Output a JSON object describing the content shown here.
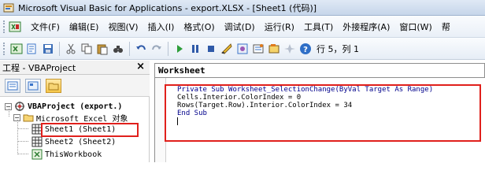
{
  "window": {
    "title": "Microsoft Visual Basic for Applications - export.XLSX - [Sheet1 (代码)]"
  },
  "menu": {
    "items": [
      "文件(F)",
      "编辑(E)",
      "视图(V)",
      "插入(I)",
      "格式(O)",
      "调试(D)",
      "运行(R)",
      "工具(T)",
      "外接程序(A)",
      "窗口(W)",
      "帮"
    ]
  },
  "toolbar": {
    "position_text": "行 5，列 1"
  },
  "project": {
    "header": "工程 - VBAProject",
    "close": "×",
    "tree": {
      "root": "VBAProject (export.)",
      "folder": "Microsoft Excel 对象",
      "items": [
        "Sheet1 (Sheet1)",
        "Sheet2 (Sheet2)",
        "ThisWorkbook"
      ]
    }
  },
  "code": {
    "object_selector": "Worksheet",
    "lines": [
      "Private Sub Worksheet_SelectionChange(ByVal Target As Range)",
      "Cells.Interior.ColorIndex = 0",
      "Rows(Target.Row).Interior.ColorIndex = 34",
      "End Sub"
    ]
  },
  "colors": {
    "highlight_border": "#e0201c",
    "keyword": "#00008b"
  }
}
